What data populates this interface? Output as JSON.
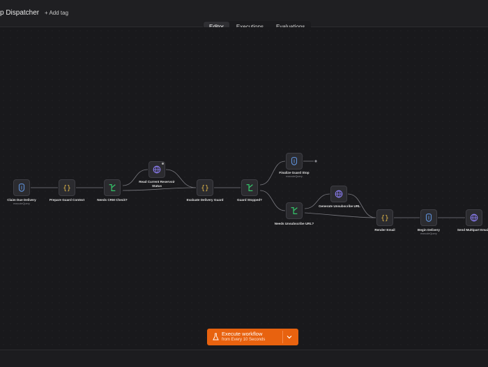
{
  "header": {
    "workflow_title": "p Dispatcher",
    "add_tag": "+ Add tag"
  },
  "tabs": [
    {
      "label": "Editor",
      "active": true
    },
    {
      "label": "Executions",
      "active": false
    },
    {
      "label": "Evaluations",
      "active": false
    }
  ],
  "nodes": [
    {
      "id": "claim",
      "label": "Claim Due Delivery",
      "sub": "executeQuery",
      "icon": "postgres-icon"
    },
    {
      "id": "prepare",
      "label": "Prepare Guard Context",
      "sub": "",
      "icon": "code-braces-icon"
    },
    {
      "id": "crm",
      "label": "Needs CRM Check?",
      "sub": "",
      "icon": "if-branch-icon"
    },
    {
      "id": "read",
      "label": "Read Current Reservoir Status",
      "sub": "",
      "icon": "http-globe-icon"
    },
    {
      "id": "evaluate",
      "label": "Evaluate Delivery Guard",
      "sub": "",
      "icon": "code-braces-icon"
    },
    {
      "id": "guard",
      "label": "Guard Stopped?",
      "sub": "",
      "icon": "if-branch-icon"
    },
    {
      "id": "finalize",
      "label": "Finalize Guard Stop",
      "sub": "executeQuery",
      "icon": "postgres-icon"
    },
    {
      "id": "unsub_check",
      "label": "Needs Unsubscribe URL?",
      "sub": "",
      "icon": "if-branch-icon"
    },
    {
      "id": "gen_unsub",
      "label": "Generate Unsubscribe URL",
      "sub": "",
      "icon": "http-globe-icon"
    },
    {
      "id": "render",
      "label": "Render Email",
      "sub": "",
      "icon": "code-braces-icon"
    },
    {
      "id": "begin",
      "label": "Begin Delivery",
      "sub": "executeQuery",
      "icon": "postgres-icon"
    },
    {
      "id": "send",
      "label": "Send Multipart Emai",
      "sub": "",
      "icon": "http-globe-icon"
    }
  ],
  "execute": {
    "label": "Execute workflow",
    "sub": "from Every 10 Seconds"
  },
  "colors": {
    "accent": "#e8620f",
    "if_green": "#35c46a",
    "code_yellow": "#e0b64a",
    "globe_purple": "#8a7cf0",
    "postgres_blue": "#5e8fd6"
  }
}
